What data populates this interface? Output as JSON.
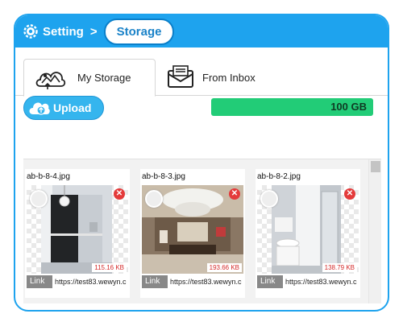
{
  "breadcrumb": {
    "root_icon": "gear-icon",
    "root_label": "Setting",
    "separator": ">",
    "current_label": "Storage"
  },
  "tabs": [
    {
      "label": "My Storage",
      "icon": "cloud-image-icon",
      "active": true
    },
    {
      "label": "From Inbox",
      "icon": "envelope-icon",
      "active": false
    }
  ],
  "toolbar": {
    "upload_label": "Upload",
    "upload_icon": "cloud-upload-icon"
  },
  "storage": {
    "label": "100 GB",
    "fill_fraction": 1.0,
    "color": "#22cc77"
  },
  "files": [
    {
      "name": "ab-b-8-4.jpg",
      "size": "115.16 KB",
      "link_label": "Link",
      "url": "https://test83.wewyn.c"
    },
    {
      "name": "ab-b-8-3.jpg",
      "size": "193.66 KB",
      "link_label": "Link",
      "url": "https://test83.wewyn.c"
    },
    {
      "name": "ab-b-8-2.jpg",
      "size": "138.79 KB",
      "link_label": "Link",
      "url": "https://test83.wewyn.c"
    }
  ],
  "colors": {
    "accent": "#1ea3ee",
    "delete": "#e43b3b",
    "size_text": "#d42a2a"
  }
}
